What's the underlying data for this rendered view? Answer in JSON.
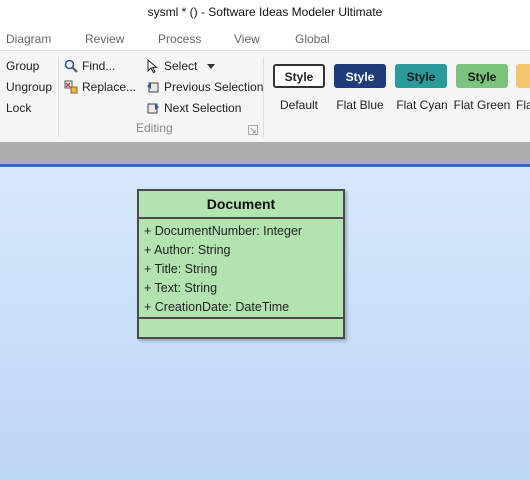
{
  "window": {
    "title": "sysml * () - Software Ideas Modeler Ultimate"
  },
  "menu": {
    "items": [
      "Diagram",
      "Review",
      "Process",
      "View",
      "Global"
    ]
  },
  "ribbon": {
    "group_cmds": {
      "group": "Group",
      "ungroup": "Ungroup",
      "lock": "Lock"
    },
    "editing": {
      "find": "Find...",
      "replace": "Replace...",
      "select": "Select",
      "previous_selection": "Previous Selection",
      "next_selection": "Next Selection",
      "label": "Editing"
    },
    "styles": [
      {
        "button": "Style",
        "caption": "Default",
        "bg": "#ffffff",
        "fg": "#222222",
        "border": "#333333"
      },
      {
        "button": "Style",
        "caption": "Flat Blue",
        "bg": "#1f3d7a",
        "fg": "#ffffff",
        "border": "#1f3d7a"
      },
      {
        "button": "Style",
        "caption": "Flat Cyan",
        "bg": "#2a9a9a",
        "fg": "#1a1a1a",
        "border": "#2a9a9a"
      },
      {
        "button": "Style",
        "caption": "Flat Green",
        "bg": "#7cc47c",
        "fg": "#1a1a1a",
        "border": "#7cc47c"
      },
      {
        "button": "",
        "caption": "Fla",
        "bg": "#f5c66e",
        "fg": "#1a1a1a",
        "border": "#f5c66e"
      }
    ]
  },
  "diagram": {
    "class_name": "Document",
    "attributes": [
      "+ DocumentNumber: Integer",
      "+ Author: String",
      "+ Title: String",
      "+ Text: String",
      "+ CreationDate: DateTime"
    ],
    "fill": "#b3e3b1"
  }
}
